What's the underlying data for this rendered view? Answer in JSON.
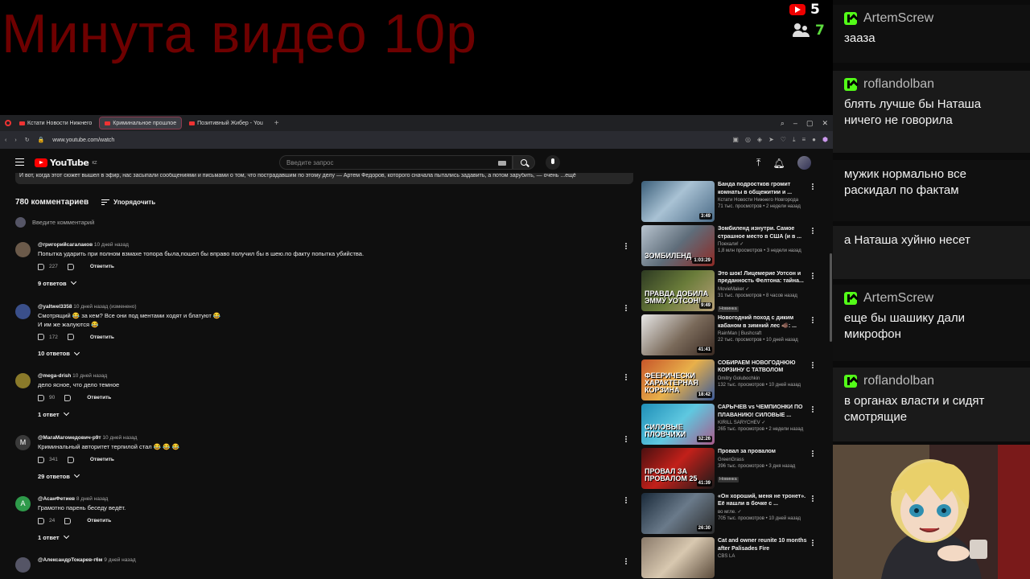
{
  "overlay": {
    "title": "Минута видео 10р",
    "youtube_count": "5",
    "viewers_count": "7"
  },
  "browser": {
    "tabs": [
      {
        "label": "Кстати Новости Нижнего"
      },
      {
        "label": "Криминальное прошлое"
      },
      {
        "label": "Позитивный Жибер - You"
      }
    ],
    "url": "www.youtube.com/watch",
    "window_controls": [
      "⌕",
      "–",
      "▢",
      "✕"
    ]
  },
  "youtube": {
    "logo": "YouTube",
    "logo_region": "KZ",
    "search_placeholder": "Введите запрос",
    "description_snippet": "И вот, когда этот сюжет вышел в эфир, нас засыпали сообщениями и письмами о том, что пострадавшим по этому делу — Артем Федоров, которого сначала пытались задавить, а потом зарубить, — очень ...ещё",
    "comments_count": "780 комментариев",
    "sort_label": "Упорядочить",
    "add_comment_placeholder": "Введите комментарий",
    "reply_label": "Ответить",
    "comments": [
      {
        "author": "@григорийсагалаков",
        "time": "10 дней назад",
        "text": "Попытка ударить при полном взмахе топора была,пошел бы вправо получил бы в шею.по факту попытка убийства.",
        "likes": "227",
        "replies": "9 ответов",
        "avatar_color": "#6b5a4a"
      },
      {
        "author": "@yaltwel3358",
        "time": "10 дней назад (изменено)",
        "text": "Смотрящий 😂 за кем? Все они под ментами ходят и блатуют 😂\nИ им же жалуются 😂",
        "likes": "172",
        "replies": "10 ответов",
        "avatar_color": "#3a4f8a"
      },
      {
        "author": "@mega-drish",
        "time": "10 дней назад",
        "text": "дело ясное, что дело темное",
        "likes": "90",
        "replies": "1 ответ",
        "avatar_color": "#8a7a2a"
      },
      {
        "author": "@МагаМагомедович-р9т",
        "time": "10 дней назад",
        "text": "Криминальный авторитет терпилой стал 😂 😂 😂",
        "likes": "341",
        "replies": "29 ответов",
        "avatar_color": "#3a3a3a",
        "avatar_letter": "M"
      },
      {
        "author": "@АсанФетиев",
        "time": "8 дней назад",
        "text": "Грамотно парень беседу ведёт.",
        "likes": "24",
        "replies": "1 ответ",
        "avatar_color": "#2e9a4a",
        "avatar_letter": "A"
      },
      {
        "author": "@АлександрТокарев-г6м",
        "time": "9 дней назад",
        "text": "",
        "likes": "",
        "replies": "",
        "avatar_color": "#556"
      }
    ],
    "recommendations": [
      {
        "title": "Банда подростков громит комнаты в общежитии и ...",
        "channel": "Кстати Новости Нижнего Новгорода",
        "stats": "71 тыс. просмотров • 2 недели назад",
        "duration": "3:49",
        "badge": "",
        "thumb": "linear-gradient(135deg,#3b5f7a,#a9c2d4 45%,#4a6a86)",
        "overlay": ""
      },
      {
        "title": "Зомбиленд изнутри. Самое страшное место в США (и в ...",
        "channel": "Поехали! ✓",
        "stats": "1,8 млн просмотров • 3 недели назад",
        "duration": "1:03:29",
        "badge": "",
        "thumb": "linear-gradient(135deg,#b8c4cf,#5f6d7a 50%,#8d2a25)",
        "overlay": "ЗОМБИЛЕНД"
      },
      {
        "title": "Это шок! Лицемерие Уотсон и преданность Фелтона: тайна...",
        "channel": "MovieMaker ✓",
        "stats": "31 тыс. просмотров • 8 часов назад",
        "duration": "9:49",
        "badge": "Новинка",
        "thumb": "linear-gradient(135deg,#2d3a22,#6a7c3a 50%,#b8a078)",
        "overlay": "ПРАВДА ДОБИЛА ЭММУ УОТСОН!"
      },
      {
        "title": "Новогодний поход с диким кабаном в зимний лес 🐗: ...",
        "channel": "RainMan | Bushcraft",
        "stats": "22 тыс. просмотров • 10 дней назад",
        "duration": "41:41",
        "badge": "",
        "thumb": "linear-gradient(135deg,#e6e6e6,#7a6a5a 55%,#3a2a22)",
        "overlay": ""
      },
      {
        "title": "СОБИРАЕМ НОВОГОДНЮЮ КОРЗИНУ С ТАТВОЛОМ",
        "channel": "Dmitry Golubochkin",
        "stats": "132 тыс. просмотров • 10 дней назад",
        "duration": "18:42",
        "badge": "",
        "thumb": "linear-gradient(135deg,#c7562a,#e8b04a 50%,#3a5a9a)",
        "overlay": "ФЕЕРИЧЕСКИ ХАРАКТЕРНАЯ КОРЗИНА"
      },
      {
        "title": "САРЫЧЕВ vs ЧЕМПИОНКИ ПО ПЛАВАНИЮ! СИЛОВЫЕ ...",
        "channel": "KIRILL SARYCHEV ✓",
        "stats": "265 тыс. просмотров • 2 недели назад",
        "duration": "32:26",
        "badge": "",
        "thumb": "linear-gradient(135deg,#1f8fb8,#5fc8e0 50%,#a85a8a)",
        "overlay": "СИЛОВЫЕ ПЛОВЧИХИ"
      },
      {
        "title": "Провал за провалом",
        "channel": "GreenGrass",
        "stats": "396 тыс. просмотров • 3 дня назад",
        "duration": "41:39",
        "badge": "Новинка",
        "thumb": "linear-gradient(135deg,#4a1010,#c2201a 45%,#1a1a1a)",
        "overlay": "ПРОВАЛ ЗА ПРОВАЛОМ 25"
      },
      {
        "title": "«Он хороший, меня не тронет». Её нашли в бочке с ...",
        "channel": "во мгле. ✓",
        "stats": "705 тыс. просмотров • 10 дней назад",
        "duration": "26:30",
        "badge": "",
        "thumb": "linear-gradient(135deg,#1a2a3a,#6a7a8a 50%,#2a2a2a)",
        "overlay": ""
      },
      {
        "title": "Cat and owner reunite 10 months after Palisades Fire",
        "channel": "CBS LA",
        "stats": "",
        "duration": "",
        "badge": "",
        "thumb": "linear-gradient(135deg,#8a7a6a,#d8c8b0 50%,#5a4a3a)",
        "overlay": ""
      }
    ]
  },
  "chat": {
    "messages": [
      {
        "user": "ArtemScrew",
        "text": "зааза"
      },
      {
        "user": "roflandolban",
        "text": "блять лучше бы Наташа ничего не говорила"
      },
      {
        "user": "",
        "text": "мужик нормально все раскидал по фактам"
      },
      {
        "user": "",
        "text": "а Наташа хуйню несет"
      },
      {
        "user": "ArtemScrew",
        "text": "еще бы шашику дали микрофон"
      },
      {
        "user": "roflandolban",
        "text": "в органах власти и сидят смотрящие"
      }
    ]
  }
}
